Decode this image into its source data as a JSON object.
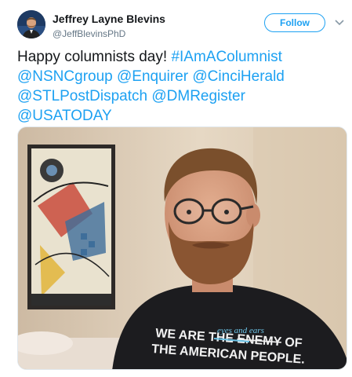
{
  "author": {
    "display_name": "Jeffrey Layne Blevins",
    "handle": "@JeffBlevinsPhD"
  },
  "actions": {
    "follow_label": "Follow",
    "more_icon": "chevron-down-icon"
  },
  "tweet": {
    "lead": "Happy columnists day!",
    "hashtag": "#IAmAColumnist",
    "mentions": [
      "@NSNCgroup",
      "@Enquirer",
      "@CinciHerald",
      "@STLPostDispatch",
      "@DMRegister",
      "@USATODAY"
    ]
  },
  "photo": {
    "shirt_small_text": "eyes and ears",
    "shirt_line1a": "WE ARE THE ",
    "shirt_line1b": "ENEMY",
    "shirt_line1c": " OF",
    "shirt_line2": "THE AMERICAN PEOPLE."
  },
  "colors": {
    "link": "#1da1f2",
    "text": "#14171a",
    "muted": "#657786"
  }
}
